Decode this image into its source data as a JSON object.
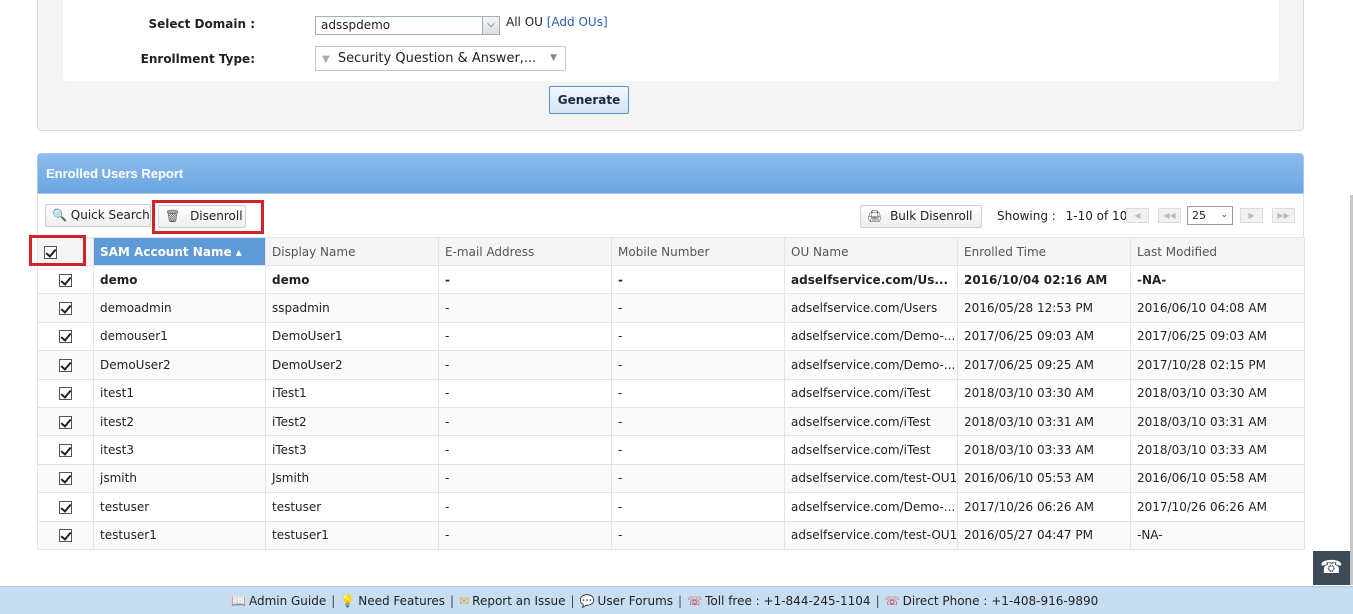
{
  "filters": {
    "domain_label": "Select Domain :",
    "domain_value": "adsspdemo",
    "all_ou_text": "All OU",
    "add_ous_link": "[Add OUs]",
    "enrollment_label": "Enrollment Type:",
    "enrollment_value": "Security Question & Answer,...",
    "generate_label": "Generate"
  },
  "report": {
    "title": "Enrolled Users Report",
    "quick_search_label": "Quick Search",
    "disenroll_label": "Disenroll",
    "bulk_disenroll_label": "Bulk Disenroll",
    "showing_label": "Showing :",
    "showing_range": "1-10 of 10",
    "page_size": "25",
    "columns": [
      "SAM Account Name ▴",
      "Display Name",
      "E-mail Address",
      "Mobile Number",
      "OU Name",
      "Enrolled Time",
      "Last Modified"
    ],
    "rows": [
      {
        "sam": "demo",
        "display": "demo",
        "email": "-",
        "mobile": "-",
        "ou": "adselfservice.com/Us...",
        "enrolled": "2016/10/04 02:16 AM",
        "modified": "-NA-"
      },
      {
        "sam": "demoadmin",
        "display": "sspadmin",
        "email": "-",
        "mobile": "-",
        "ou": "adselfservice.com/Users",
        "enrolled": "2016/05/28 12:53 PM",
        "modified": "2016/06/10 04:08 AM"
      },
      {
        "sam": "demouser1",
        "display": "DemoUser1",
        "email": "-",
        "mobile": "-",
        "ou": "adselfservice.com/Demo-...",
        "enrolled": "2017/06/25 09:03 AM",
        "modified": "2017/06/25 09:03 AM"
      },
      {
        "sam": "DemoUser2",
        "display": "DemoUser2",
        "email": "-",
        "mobile": "-",
        "ou": "adselfservice.com/Demo-...",
        "enrolled": "2017/06/25 09:25 AM",
        "modified": "2017/10/28 02:15 PM"
      },
      {
        "sam": "itest1",
        "display": "iTest1",
        "email": "-",
        "mobile": "-",
        "ou": "adselfservice.com/iTest",
        "enrolled": "2018/03/10 03:30 AM",
        "modified": "2018/03/10 03:30 AM"
      },
      {
        "sam": "itest2",
        "display": "iTest2",
        "email": "-",
        "mobile": "-",
        "ou": "adselfservice.com/iTest",
        "enrolled": "2018/03/10 03:31 AM",
        "modified": "2018/03/10 03:31 AM"
      },
      {
        "sam": "itest3",
        "display": "iTest3",
        "email": "-",
        "mobile": "-",
        "ou": "adselfservice.com/iTest",
        "enrolled": "2018/03/10 03:33 AM",
        "modified": "2018/03/10 03:33 AM"
      },
      {
        "sam": "jsmith",
        "display": "Jsmith",
        "email": "-",
        "mobile": "-",
        "ou": "adselfservice.com/test-OU1",
        "enrolled": "2016/06/10 05:53 AM",
        "modified": "2016/06/10 05:58 AM"
      },
      {
        "sam": "testuser",
        "display": "testuser",
        "email": "-",
        "mobile": "-",
        "ou": "adselfservice.com/Demo-...",
        "enrolled": "2017/10/26 06:26 AM",
        "modified": "2017/10/26 06:26 AM"
      },
      {
        "sam": "testuser1",
        "display": "testuser1",
        "email": "-",
        "mobile": "-",
        "ou": "adselfservice.com/test-OU1",
        "enrolled": "2016/05/27 04:47 PM",
        "modified": "-NA-"
      }
    ]
  },
  "footer": {
    "admin_guide": "Admin Guide",
    "need_features": "Need Features",
    "report_issue": "Report an Issue",
    "user_forums": "User Forums",
    "toll_free": "Toll free : +1-844-245-1104",
    "direct_phone": "Direct Phone : +1-408-916-9890"
  },
  "icons": {
    "search": "magnifier-icon",
    "disenroll": "trash-icon",
    "bulk": "printer-icon",
    "help": "headset-icon"
  },
  "colors": {
    "header_blue": "#6aa6e2",
    "highlight_red": "#d2232a",
    "footer_bg": "#c7ddf2"
  }
}
